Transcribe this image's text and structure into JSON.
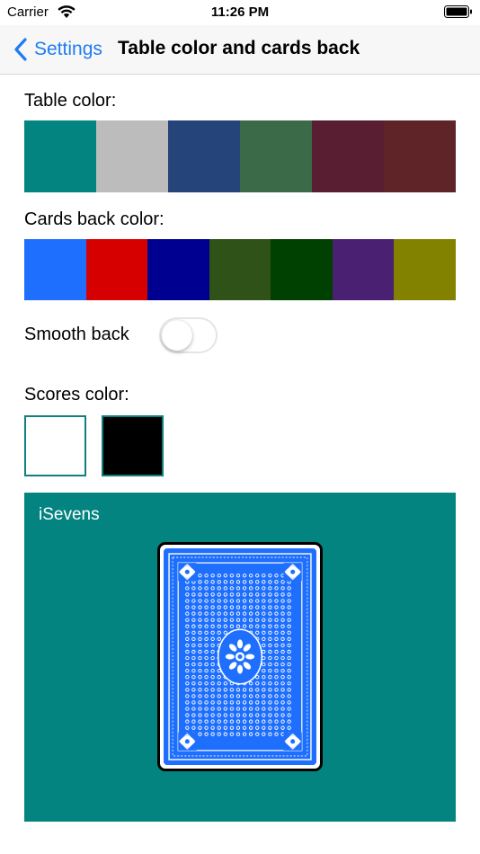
{
  "status_bar": {
    "carrier": "Carrier",
    "time": "11:26 PM"
  },
  "nav": {
    "back_label": "Settings",
    "title": "Table color and cards back"
  },
  "table_color": {
    "label": "Table color:",
    "swatches": [
      "#048480",
      "#bcbcbc",
      "#24447a",
      "#3a6a48",
      "#5a1e32",
      "#5e2428"
    ]
  },
  "cards_back_color": {
    "label": "Cards back color:",
    "swatches": [
      "#1f6fff",
      "#d60000",
      "#000090",
      "#2e5218",
      "#004000",
      "#4a2072",
      "#828200"
    ]
  },
  "smooth_back": {
    "label": "Smooth back",
    "on": false
  },
  "scores_color": {
    "label": "Scores color:",
    "swatches": [
      "#ffffff",
      "#000000"
    ]
  },
  "preview": {
    "title": "iSevens",
    "table_color": "#048480",
    "card_back_color": "#1f6fff"
  }
}
